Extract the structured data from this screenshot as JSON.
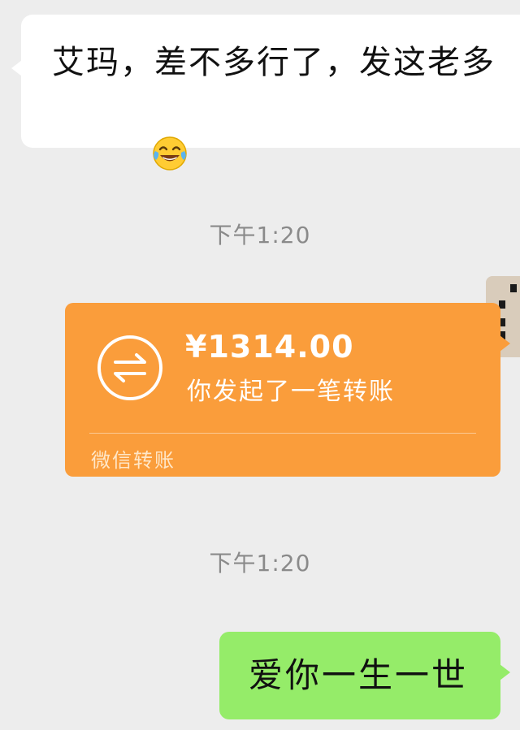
{
  "colors": {
    "background": "#ededed",
    "incoming_bubble": "#ffffff",
    "transfer_card": "#fa9d3b",
    "outgoing_bubble": "#95ec69",
    "timestamp_text": "#8a8a8a"
  },
  "messages": {
    "incoming": {
      "text": "艾玛，差不多行了，发这老多",
      "emoji_icon": "tears-of-joy-emoji-icon"
    },
    "timestamp_1": "下午1:20",
    "transfer": {
      "icon": "transfer-arrows-icon",
      "amount": "¥1314.00",
      "description": "你发起了一笔转账",
      "footer": "微信转账"
    },
    "timestamp_2": "下午1:20",
    "outgoing": {
      "text": "爱你一生一世"
    }
  }
}
